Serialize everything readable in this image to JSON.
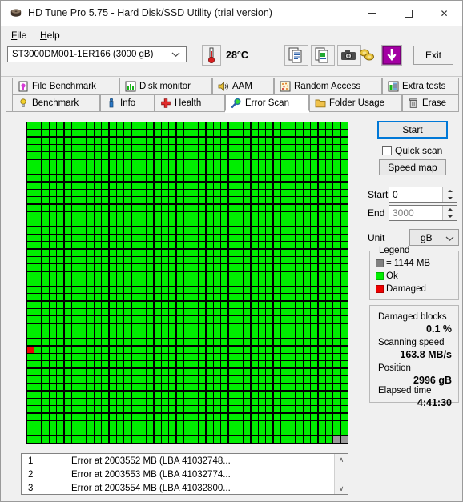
{
  "window": {
    "title": "HD Tune Pro 5.75 - Hard Disk/SSD Utility (trial version)",
    "icon": "hard-disk-icon",
    "minimize_label": "",
    "maximize_label": "",
    "close_label": "✕"
  },
  "menu": {
    "items": [
      {
        "acc": "F",
        "rest": "ile"
      },
      {
        "acc": "H",
        "rest": "elp"
      }
    ]
  },
  "toolbar": {
    "drive": "ST3000DM001-1ER166 (3000 gB)",
    "temperature": "28°C",
    "buttons": [
      {
        "name": "copy-text-icon"
      },
      {
        "name": "copy-image-icon"
      },
      {
        "name": "screenshot-camera-icon"
      },
      {
        "name": "coins-icon"
      },
      {
        "name": "download-arrow-icon"
      }
    ],
    "exit_label": "Exit"
  },
  "tabs": {
    "top_row": [
      {
        "label": "File Benchmark",
        "icon": "bulb-magenta-icon"
      },
      {
        "label": "Disk monitor",
        "icon": "bar-chart-icon"
      },
      {
        "label": "AAM",
        "icon": "speaker-icon"
      },
      {
        "label": "Random Access",
        "icon": "scatter-dots-icon"
      },
      {
        "label": "Extra tests",
        "icon": "chart-grid-icon"
      }
    ],
    "bottom_row": [
      {
        "label": "Benchmark",
        "icon": "bulb-yellow-icon",
        "active": false
      },
      {
        "label": "Info",
        "icon": "info-icon",
        "active": false
      },
      {
        "label": "Health",
        "icon": "red-cross-icon",
        "active": false
      },
      {
        "label": "Error Scan",
        "icon": "magnifier-icon",
        "active": true
      },
      {
        "label": "Folder Usage",
        "icon": "folder-icon",
        "active": false
      },
      {
        "label": "Erase",
        "icon": "trash-icon",
        "active": false
      }
    ]
  },
  "panel": {
    "start_button": "Start",
    "quick_scan_label": "Quick scan",
    "quick_scan_checked": false,
    "speed_map_button": "Speed map",
    "range_start_label": "Start",
    "range_start_value": "0",
    "range_end_label": "End",
    "range_end_value": "3000",
    "unit_label": "Unit",
    "unit_value": "gB",
    "legend": {
      "title": "Legend",
      "block_size": "= 1144 MB",
      "ok_label": "Ok",
      "damaged_label": "Damaged",
      "color_block": "#808080",
      "color_ok": "#00ee00",
      "color_damaged": "#ee0000"
    },
    "stats": [
      {
        "label": "Damaged blocks",
        "value": "0.1 %"
      },
      {
        "label": "Scanning speed",
        "value": "163.8 MB/s"
      },
      {
        "label": "Position",
        "value": "2996 gB"
      },
      {
        "label": "Elapsed time",
        "value": "4:41:30"
      }
    ]
  },
  "error_list": {
    "rows": [
      {
        "index": "1",
        "text": "Error at 2003552 MB (LBA 41032748..."
      },
      {
        "index": "2",
        "text": "Error at 2003553 MB (LBA 41032774..."
      },
      {
        "index": "3",
        "text": "Error at 2003554 MB (LBA 41032800..."
      }
    ],
    "scroll_up": "∧",
    "scroll_down": "∨"
  },
  "map": {
    "columns": 43,
    "rows": 43,
    "damaged_cells": [
      [
        30,
        0
      ]
    ],
    "unscanned_cells": [
      [
        42,
        41
      ],
      [
        42,
        42
      ]
    ],
    "color_ok": "#00ee00",
    "color_damaged": "#ee0000",
    "color_unscanned": "#9a9a9a",
    "color_grid": "#000000"
  }
}
